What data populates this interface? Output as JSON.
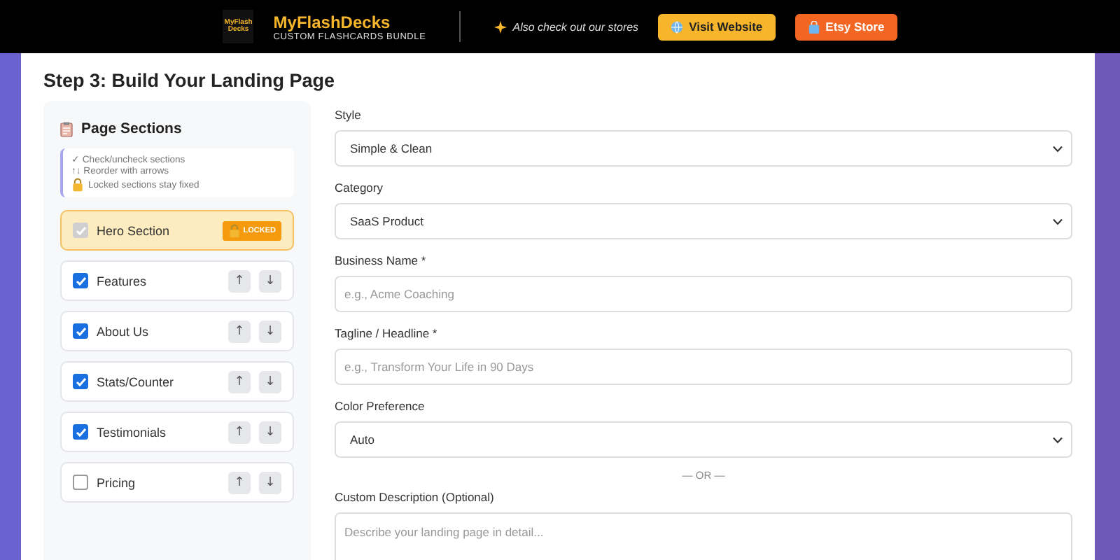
{
  "banner": {
    "brand": "MyFlashDecks",
    "logo_text": "MyFlash Decks",
    "subtitle": "CUSTOM FLASHCARDS BUNDLE",
    "promo": "Also check out our stores",
    "buttons": [
      {
        "label": "Visit Website",
        "kind": "website"
      },
      {
        "label": "Etsy Store",
        "kind": "etsy"
      }
    ]
  },
  "heading": "Step 3: Build Your Landing Page",
  "sections_panel": {
    "title": "Page Sections",
    "hints": [
      "✓ Check/uncheck sections",
      "↑↓ Reorder with arrows",
      "Locked sections stay fixed"
    ],
    "items": [
      {
        "label": "Hero Section",
        "checked": true,
        "locked": true,
        "badge": "LOCKED"
      },
      {
        "label": "Features",
        "checked": true,
        "locked": false,
        "up": "↑",
        "down": "↓"
      },
      {
        "label": "About Us",
        "checked": true,
        "locked": false,
        "up": "↑",
        "down": "↓"
      },
      {
        "label": "Stats/Counter",
        "checked": true,
        "locked": false,
        "up": "↑",
        "down": "↓"
      },
      {
        "label": "Testimonials",
        "checked": true,
        "locked": false,
        "up": "↑",
        "down": "↓"
      },
      {
        "label": "Pricing",
        "checked": false,
        "locked": false,
        "up": "↑",
        "down": "↓"
      }
    ]
  },
  "form": {
    "fields": [
      {
        "kind": "select",
        "label": "Style",
        "value": "Simple & Clean"
      },
      {
        "kind": "select",
        "label": "Category",
        "value": "SaaS Product"
      },
      {
        "kind": "input",
        "label": "Business Name *",
        "placeholder": "e.g., Acme Coaching"
      },
      {
        "kind": "input",
        "label": "Tagline / Headline *",
        "placeholder": "e.g., Transform Your Life in 90 Days"
      },
      {
        "kind": "select",
        "label": "Color Preference",
        "value": "Auto"
      },
      {
        "kind": "divider",
        "label": "— OR —"
      },
      {
        "kind": "textarea",
        "label": "Custom Description (Optional)",
        "placeholder": "Describe your landing page in detail..."
      }
    ]
  }
}
